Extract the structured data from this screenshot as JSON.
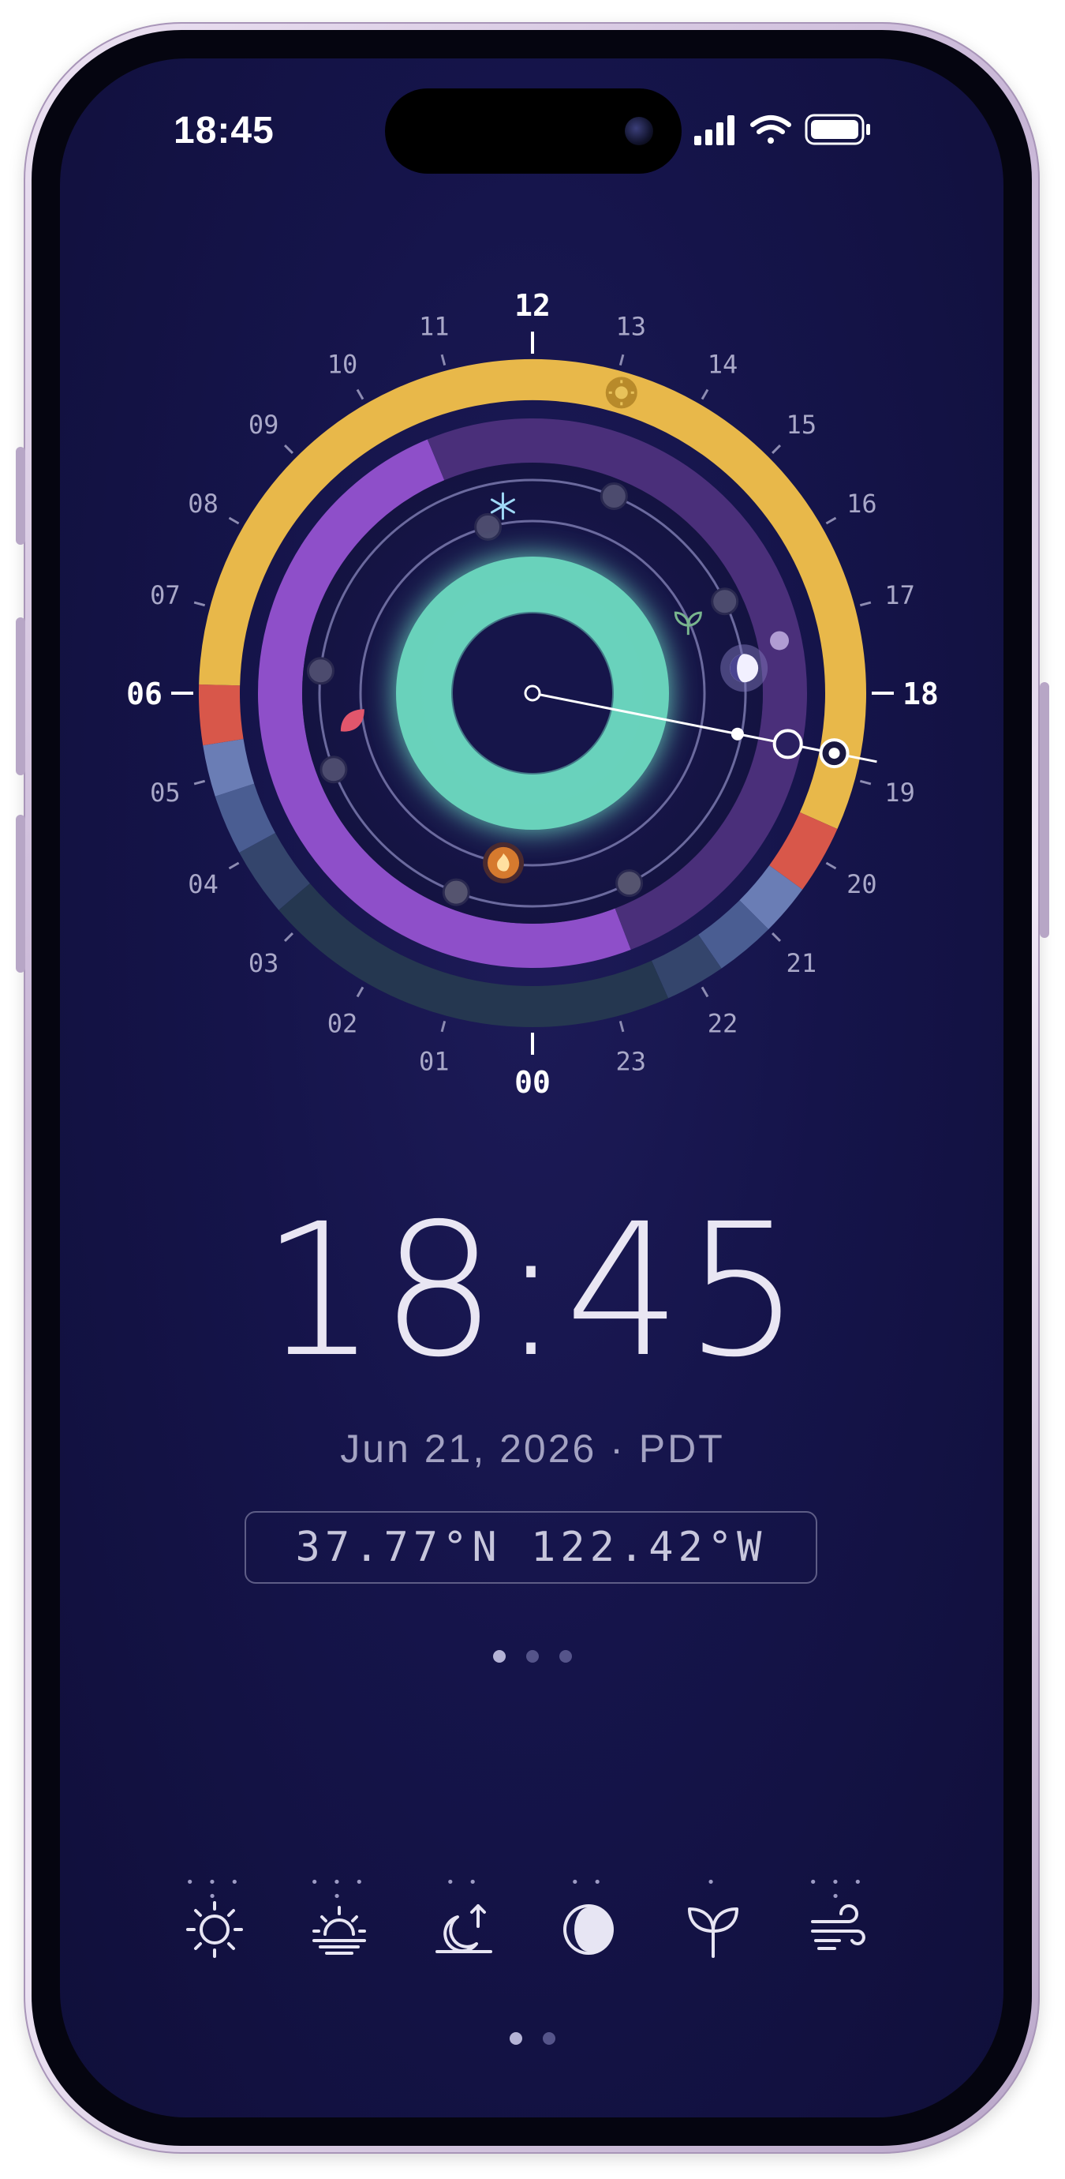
{
  "status_bar": {
    "time": "18:45"
  },
  "dial": {
    "hour_labels": [
      "00",
      "01",
      "02",
      "03",
      "04",
      "05",
      "06",
      "07",
      "08",
      "09",
      "10",
      "11",
      "12",
      "13",
      "14",
      "15",
      "16",
      "17",
      "18",
      "19",
      "20",
      "21",
      "22",
      "23"
    ],
    "major_hours": [
      "00",
      "06",
      "12",
      "18"
    ],
    "current_time_marker": "18:45",
    "sunrise_label": "06",
    "sunset_label": "18",
    "icons": [
      "sun-icon",
      "snowflake-icon",
      "sprout-icon",
      "leaf-icon",
      "flame-icon",
      "moon-icon"
    ],
    "colors": {
      "day": "#E8B84A",
      "twilight_red": "#D8574A",
      "blue_hour": "#6A7DB5",
      "night": "#253750",
      "moon_ring": "#8E4FC9",
      "moon_ring_dim": "#4A2F7A",
      "center_ring": "#6EDDC2"
    }
  },
  "main": {
    "time": "18:45",
    "date": "Jun 21, 2026 · PDT",
    "coordinates": "37.77°N 122.42°W"
  },
  "page_indicator": {
    "count": 3,
    "active": 0
  },
  "toolbar": {
    "items": [
      {
        "name": "sun",
        "icon": "sun-icon",
        "pips": "• • • •"
      },
      {
        "name": "sunrise",
        "icon": "sunrise-icon",
        "pips": "• • • •"
      },
      {
        "name": "moonrise",
        "icon": "moonrise-icon",
        "pips": "• •"
      },
      {
        "name": "moon-phase",
        "icon": "moon-phase-icon",
        "pips": "• •"
      },
      {
        "name": "growth",
        "icon": "sprout-icon",
        "pips": "•"
      },
      {
        "name": "wind",
        "icon": "wind-icon",
        "pips": "• • • •"
      }
    ]
  },
  "bottom_pages": {
    "count": 2,
    "active": 0
  }
}
